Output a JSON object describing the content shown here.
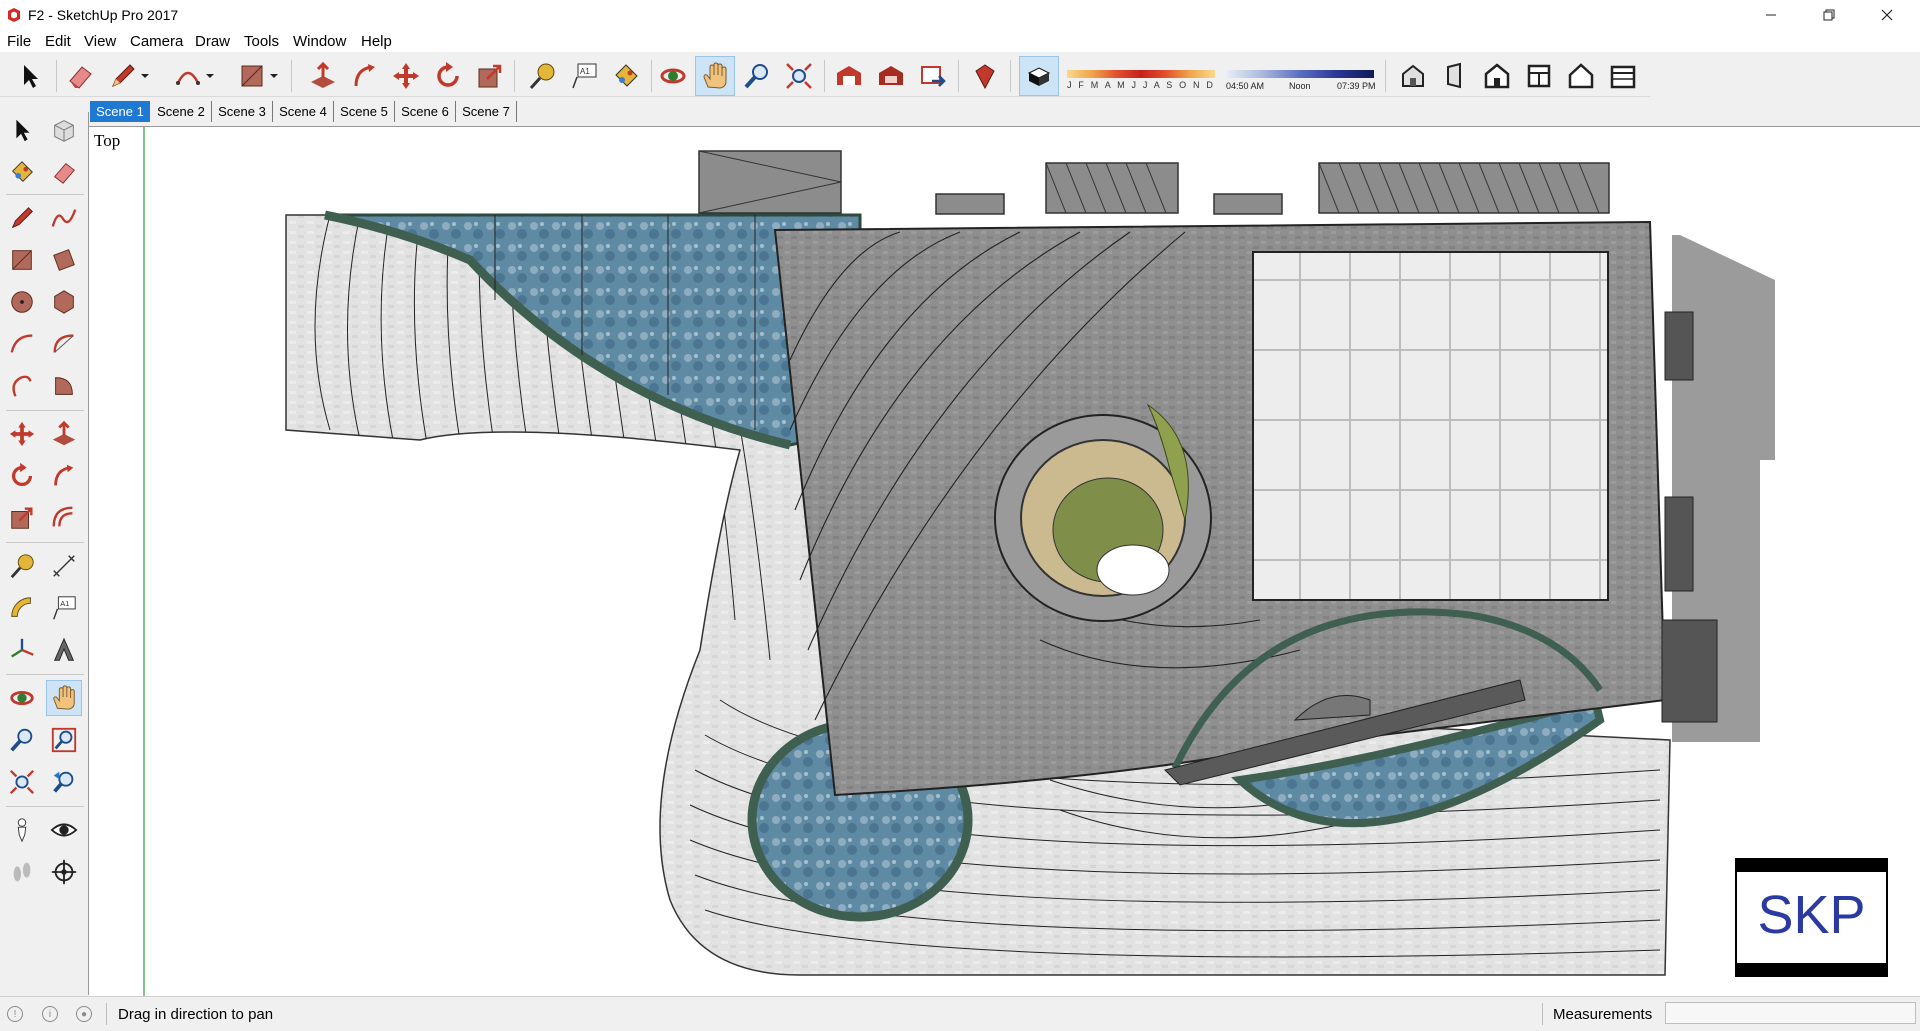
{
  "window": {
    "title": "F2 - SketchUp Pro 2017",
    "minimize_icon": "minimize-icon",
    "maximize_icon": "restore-icon",
    "close_icon": "close-icon"
  },
  "menu": [
    "File",
    "Edit",
    "View",
    "Camera",
    "Draw",
    "Tools",
    "Window",
    "Help"
  ],
  "toolbar": {
    "tools": [
      "select",
      "eraser",
      "pencil",
      "arc",
      "rectangle",
      "push-pull",
      "follow-me",
      "move",
      "rotate",
      "scale",
      "tape-measure",
      "text",
      "paint-bucket",
      "orbit",
      "pan",
      "zoom",
      "zoom-extents",
      "warehouse",
      "extension-warehouse",
      "send-to-layout",
      "ruby",
      "shadows",
      "iso",
      "front",
      "home",
      "top-slice",
      "house",
      "section"
    ],
    "active_tool": "pan",
    "shadow_months": "J F M A M J J A S O N D",
    "time_start": "04:50 AM",
    "time_mid": "Noon",
    "time_end": "07:39 PM"
  },
  "scenes": {
    "tabs": [
      "Scene 1",
      "Scene 2",
      "Scene 3",
      "Scene 4",
      "Scene 5",
      "Scene 6",
      "Scene 7"
    ],
    "active": "Scene 1"
  },
  "viewport": {
    "view_label": "Top",
    "logo_text": "SKP"
  },
  "status": {
    "message": "Drag in direction to pan",
    "measurements_label": "Measurements",
    "measurements_value": ""
  },
  "colors": {
    "accent": "#1f78d1",
    "active_tool_bg": "#cde4f7",
    "water": "#5d8aa6",
    "pavement": "#8e8e8e",
    "stone": "#e3e3e3"
  }
}
